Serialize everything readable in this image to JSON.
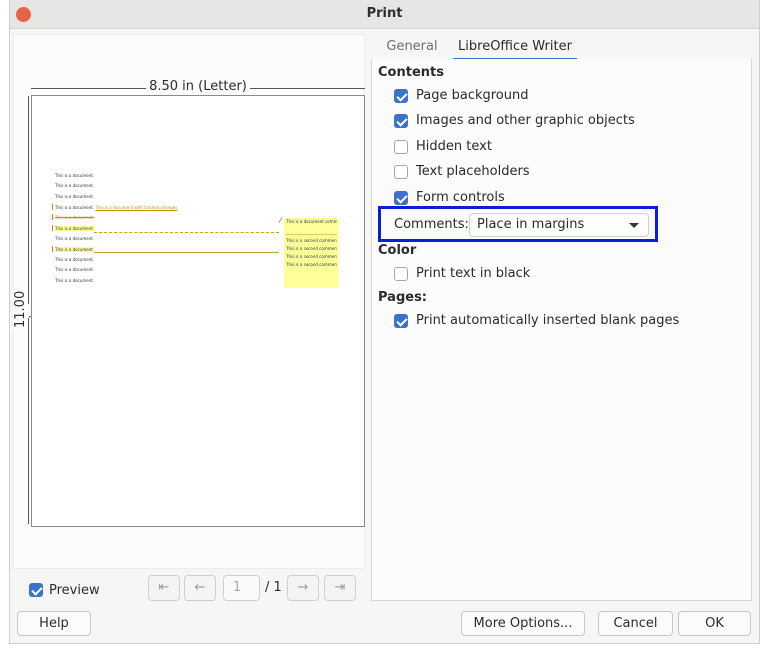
{
  "window": {
    "title": "Print"
  },
  "preview": {
    "width_label": "8.50 in (Letter)",
    "height_label": "11.00 in",
    "document_lines": [
      "This is a document.",
      "This is a document.",
      "This is a document.",
      "This is a document.",
      "This is a document.",
      "This is a document.",
      "This is a document.",
      "This is a document.",
      "This is a document.",
      "This is a document.",
      "This is a document."
    ],
    "tracked_text": "This is a document with tracked changes",
    "comment_lines": [
      "This is a document comment.",
      "This is a second comment.",
      "This is a second comment.",
      "This is a second comment.",
      "This is a second comment."
    ],
    "preview_label": "Preview",
    "preview_checked": true,
    "page_current": "1",
    "page_total": "/ 1"
  },
  "tabs": [
    {
      "label": "General",
      "active": false
    },
    {
      "label": "LibreOffice Writer",
      "active": true
    }
  ],
  "contents": {
    "heading": "Contents",
    "options": [
      {
        "label": "Page background",
        "checked": true
      },
      {
        "label": "Images and other graphic objects",
        "checked": true
      },
      {
        "label": "Hidden text",
        "checked": false
      },
      {
        "label": "Text placeholders",
        "checked": false
      },
      {
        "label": "Form controls",
        "checked": true
      }
    ],
    "comments_label": "Comments:",
    "comments_value": "Place in margins"
  },
  "color": {
    "heading": "Color",
    "option": {
      "label": "Print text in black",
      "checked": false
    }
  },
  "pages": {
    "heading": "Pages:",
    "option": {
      "label": "Print automatically inserted blank pages",
      "checked": true
    }
  },
  "buttons": {
    "help": "Help",
    "more_options": "More Options...",
    "cancel": "Cancel",
    "ok": "OK"
  },
  "colors": {
    "accent": "#3b73c8",
    "highlight": "#0a1fd6",
    "close": "#e8624a",
    "comment_bg": "#ffff99"
  }
}
